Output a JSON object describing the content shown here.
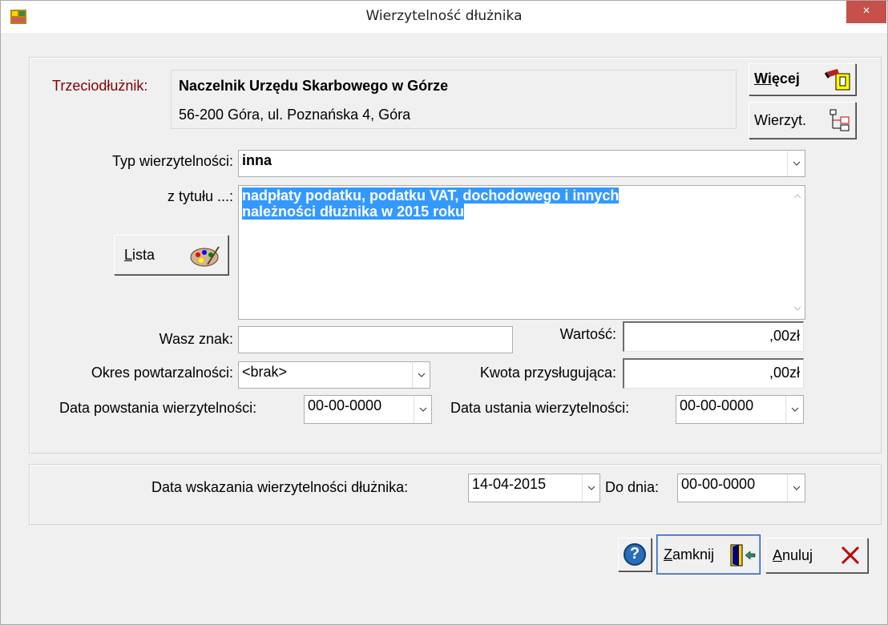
{
  "window": {
    "title": "Wierzytelność dłużnika",
    "close_glyph": "×"
  },
  "debtor": {
    "label": "Trzeciodłużnik:",
    "name": "Naczelnik Urzędu Skarbowego w Górze",
    "address": "56-200 Góra, ul. Poznańska 4, Góra"
  },
  "buttons": {
    "more_pre": "W",
    "more_acc": "i",
    "more_post": "ęcej",
    "claims_label": "Wierzyt.",
    "list_acc": "L",
    "list_post": "ista",
    "close_acc": "Z",
    "close_post": "amknij",
    "cancel_acc": "A",
    "cancel_post": "nuluj",
    "help_glyph": "?"
  },
  "form": {
    "claim_type_label": "Typ wierzytelności:",
    "claim_type_value": "inna",
    "title_label": "z tytułu ...:",
    "title_line1": "nadpłaty podatku, podatku VAT, dochodowego i innych",
    "title_line2": "należności dłużnika w 2015 roku",
    "your_ref_label": "Wasz znak:",
    "your_ref_value": "",
    "value_label": "Wartość:",
    "value_value": ",00zł",
    "period_label": "Okres powtarzalności:",
    "period_value": "<brak>",
    "due_amount_label": "Kwota przysługująca:",
    "due_amount_value": ",00zł",
    "created_label": "Data powstania wierzytelności:",
    "created_value": "00-00-0000",
    "expired_label": "Data ustania wierzytelności:",
    "expired_value": "00-00-0000"
  },
  "indication": {
    "date_label": "Data wskazania wierzytelności dłużnika:",
    "date_value": "14-04-2015",
    "until_label": "Do dnia:",
    "until_value": "00-00-0000"
  },
  "colors": {
    "accent_label": "#800000",
    "selection": "#3399ff",
    "close": "#c7504b"
  }
}
